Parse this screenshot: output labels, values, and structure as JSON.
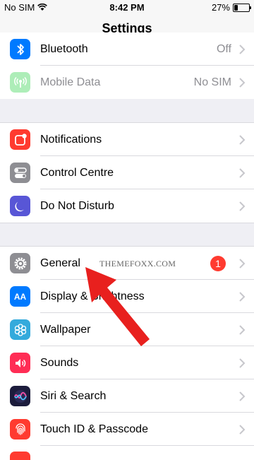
{
  "status": {
    "carrier": "No SIM",
    "time": "8:42 PM",
    "battery": "27%",
    "battery_level": 0.27
  },
  "nav": {
    "title": "Settings"
  },
  "group1": [
    {
      "label": "Bluetooth",
      "value": "Off",
      "icon": "bluetooth-icon",
      "color": "#007aff"
    },
    {
      "label": "Mobile Data",
      "value": "No SIM",
      "icon": "mobile-data-icon",
      "color": "#4cd964"
    }
  ],
  "group2": [
    {
      "label": "Notifications",
      "icon": "notifications-icon",
      "color": "#ff3b30"
    },
    {
      "label": "Control Centre",
      "icon": "control-centre-icon",
      "color": "#8e8e93"
    },
    {
      "label": "Do Not Disturb",
      "icon": "moon-icon",
      "color": "#5856d6"
    }
  ],
  "group3": [
    {
      "label": "General",
      "badge": "1",
      "icon": "gear-icon",
      "color": "#8e8e93"
    },
    {
      "label": "Display & Brightness",
      "icon": "display-icon",
      "color": "#007aff",
      "icon_text": "AA"
    },
    {
      "label": "Wallpaper",
      "icon": "wallpaper-icon",
      "color": "#34aadc"
    },
    {
      "label": "Sounds",
      "icon": "speaker-icon",
      "color": "#ff2d55"
    },
    {
      "label": "Siri & Search",
      "icon": "siri-icon",
      "color": "#1c1c3c"
    },
    {
      "label": "Touch ID & Passcode",
      "icon": "fingerprint-icon",
      "color": "#ff3b30"
    }
  ],
  "watermark": "THEMEFOXX.COM",
  "annotation_color": "#e8201e"
}
